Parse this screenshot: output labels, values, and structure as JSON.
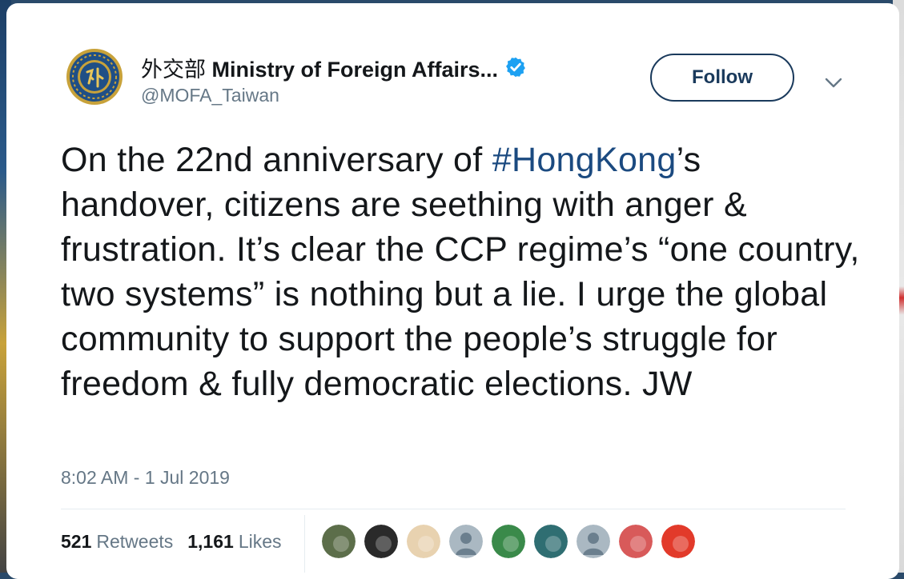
{
  "account": {
    "name_cjk": "外交部",
    "name_en": "Ministry of Foreign Affairs...",
    "handle": "@MOFA_Taiwan",
    "verified": true,
    "avatar_icon": "mofa-emblem-icon",
    "avatar_colors": {
      "ring": "#c8a23a",
      "inner": "#1f4f86"
    }
  },
  "follow_button": {
    "label": "Follow"
  },
  "more_menu": {
    "icon": "chevron-down-icon"
  },
  "tweet": {
    "text_before": "On the 22nd anniversary of ",
    "hashtag": "#HongKong",
    "text_after": "’s handover, citizens are seething with anger & frustration. It’s clear the CCP regime’s “one country, two systems” is nothing but a lie. I urge the global community to support the people’s struggle for freedom & fully democratic elections. JW"
  },
  "timestamp": "8:02 AM - 1 Jul 2019",
  "stats": {
    "retweets_count": "521",
    "retweets_label": "Retweets",
    "likes_count": "1,161",
    "likes_label": "Likes"
  },
  "likers": [
    {
      "name": "liker-avatar-1",
      "color": "#5c6e4a"
    },
    {
      "name": "liker-avatar-2",
      "color": "#2a2a2a"
    },
    {
      "name": "liker-avatar-3",
      "color": "#e8d2b0"
    },
    {
      "name": "liker-avatar-4",
      "color": "#aab8c2"
    },
    {
      "name": "liker-avatar-5",
      "color": "#3a8a4a"
    },
    {
      "name": "liker-avatar-6",
      "color": "#2f6e72"
    },
    {
      "name": "liker-avatar-7",
      "color": "#aab8c2"
    },
    {
      "name": "liker-avatar-8",
      "color": "#d85a5a"
    },
    {
      "name": "liker-avatar-9",
      "color": "#e23a2a"
    }
  ],
  "colors": {
    "link": "#1b4a80",
    "follow_border": "#1a3a5c",
    "verified": "#1da1f2",
    "secondary_text": "#657786"
  }
}
